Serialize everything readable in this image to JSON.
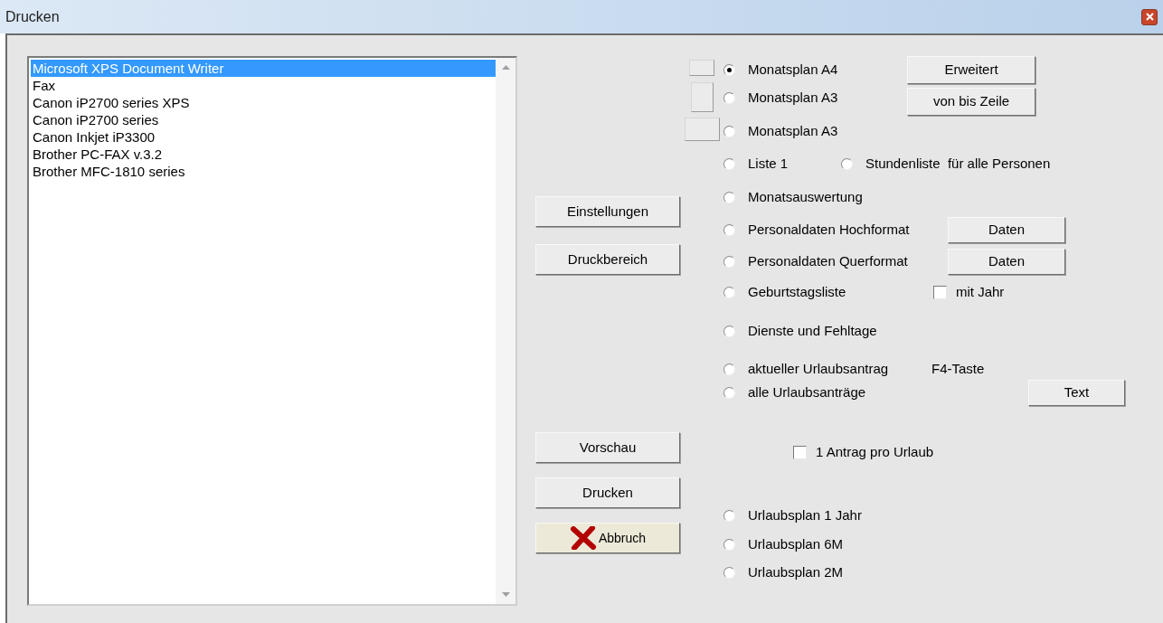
{
  "window": {
    "title": "Drucken"
  },
  "printers": [
    {
      "label": "Microsoft XPS Document Writer",
      "selected": true
    },
    {
      "label": "Fax",
      "selected": false
    },
    {
      "label": "Canon iP2700 series XPS",
      "selected": false
    },
    {
      "label": "Canon iP2700 series",
      "selected": false
    },
    {
      "label": "Canon Inkjet iP3300",
      "selected": false
    },
    {
      "label": "Brother PC-FAX v.3.2",
      "selected": false
    },
    {
      "label": "Brother MFC-1810 series",
      "selected": false
    }
  ],
  "action_buttons": [
    {
      "label": "Einstellungen",
      "kind": "plain"
    },
    {
      "label": "Druckbereich",
      "kind": "plain"
    },
    {
      "label": "Vorschau",
      "kind": "plain"
    },
    {
      "label": "Drucken",
      "kind": "plain"
    },
    {
      "label": "Abbruch",
      "kind": "cancel"
    }
  ],
  "top_group": {
    "options": [
      {
        "label": "Monatsplan A4",
        "selected": true
      },
      {
        "label": "Monatsplan A3",
        "selected": false
      },
      {
        "label": "Monatsplan A3",
        "selected": false
      }
    ],
    "buttons": [
      "Erweitert",
      "von bis Zeile"
    ]
  },
  "option_rows": [
    [
      {
        "kind": "radio",
        "label": "Liste 1",
        "selected": false
      },
      {
        "kind": "radio",
        "label": "Stundenliste  für alle Personen",
        "selected": false
      }
    ],
    [
      {
        "kind": "radio",
        "label": "Monatsauswertung",
        "selected": false
      }
    ],
    [
      {
        "kind": "radio",
        "label": "Personaldaten Hochformat",
        "selected": false
      },
      {
        "kind": "button",
        "label": "Daten"
      }
    ],
    [
      {
        "kind": "radio",
        "label": "Personaldaten Querformat",
        "selected": false
      },
      {
        "kind": "button",
        "label": "Daten"
      }
    ],
    [
      {
        "kind": "radio",
        "label": "Geburtstagsliste",
        "selected": false
      },
      {
        "kind": "checkbox",
        "label": "mit Jahr",
        "checked": false
      }
    ],
    [
      {
        "kind": "radio",
        "label": "Dienste und Fehltage",
        "selected": false
      }
    ],
    [
      {
        "kind": "radio",
        "label": "aktueller Urlaubsantrag",
        "selected": false
      },
      {
        "kind": "note",
        "label": "F4-Taste"
      }
    ],
    [
      {
        "kind": "radio",
        "label": "alle Urlaubsanträge",
        "selected": false
      },
      {
        "kind": "button",
        "label": "Text"
      }
    ],
    [
      {
        "kind": "checkbox",
        "label": "1 Antrag pro Urlaub",
        "checked": false
      }
    ],
    [
      {
        "kind": "radio",
        "label": "Urlaubsplan 1 Jahr",
        "selected": false
      }
    ],
    [
      {
        "kind": "radio",
        "label": "Urlaubsplan 6M",
        "selected": false
      }
    ],
    [
      {
        "kind": "radio",
        "label": "Urlaubsplan 2M",
        "selected": false
      }
    ]
  ]
}
